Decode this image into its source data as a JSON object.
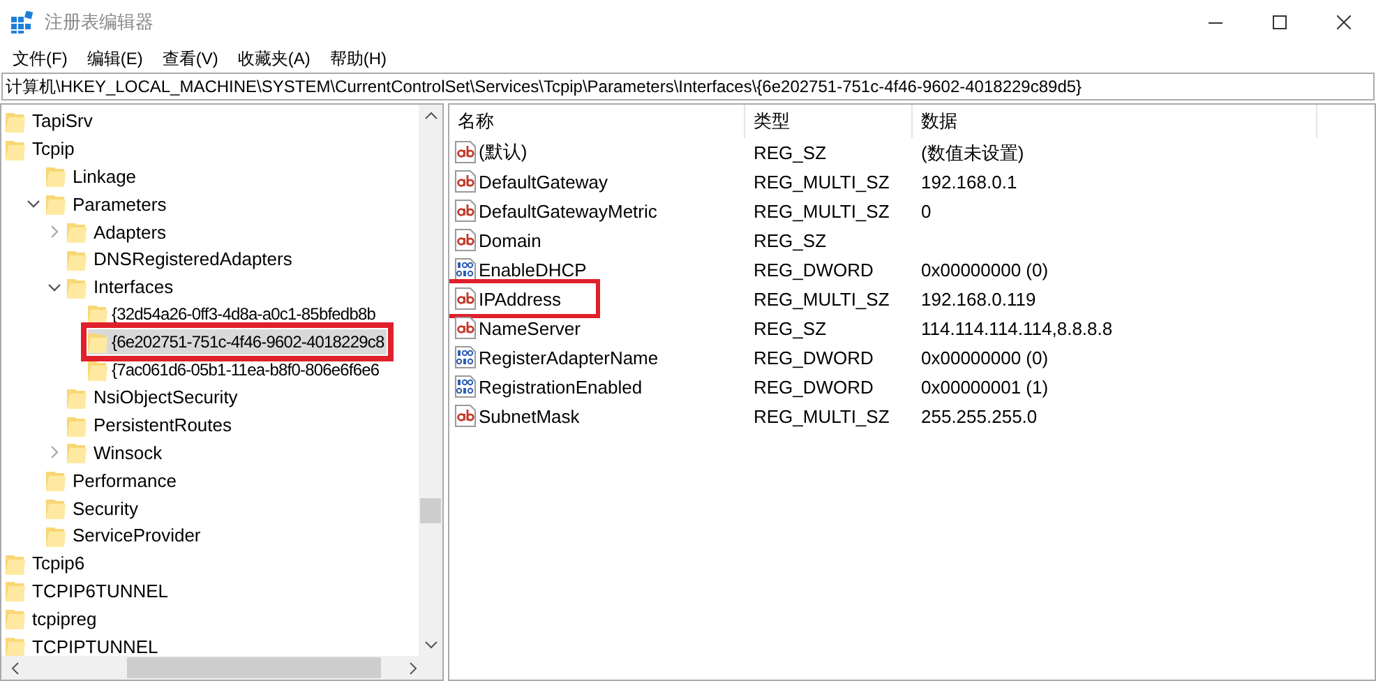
{
  "window": {
    "title": "注册表编辑器"
  },
  "menu": [
    "文件(F)",
    "编辑(E)",
    "查看(V)",
    "收藏夹(A)",
    "帮助(H)"
  ],
  "address": "计算机\\HKEY_LOCAL_MACHINE\\SYSTEM\\CurrentControlSet\\Services\\Tcpip\\Parameters\\Interfaces\\{6e202751-751c-4f46-9602-4018229c89d5}",
  "tree": [
    {
      "label": "TapiSrv",
      "selected": false
    },
    {
      "label": "Tcpip",
      "selected": false,
      "children": [
        {
          "label": "Linkage",
          "selected": false
        },
        {
          "label": "Parameters",
          "selected": false,
          "expanded": true,
          "children": [
            {
              "label": "Adapters",
              "selected": false,
              "expanded": false
            },
            {
              "label": "DNSRegisteredAdapters",
              "selected": false
            },
            {
              "label": "Interfaces",
              "selected": false,
              "expanded": true,
              "children": [
                {
                  "label": "{32d54a26-0ff3-4d8a-a0c1-85bfedb8b",
                  "selected": false
                },
                {
                  "label": "{6e202751-751c-4f46-9602-4018229c8",
                  "selected": true,
                  "highlighted": true
                },
                {
                  "label": "{7ac061d6-05b1-11ea-b8f0-806e6f6e6",
                  "selected": false
                }
              ]
            },
            {
              "label": "NsiObjectSecurity",
              "selected": false
            },
            {
              "label": "PersistentRoutes",
              "selected": false
            },
            {
              "label": "Winsock",
              "selected": false,
              "expanded": false
            }
          ]
        },
        {
          "label": "Performance",
          "selected": false
        },
        {
          "label": "Security",
          "selected": false
        },
        {
          "label": "ServiceProvider",
          "selected": false
        }
      ]
    },
    {
      "label": "Tcpip6",
      "selected": false
    },
    {
      "label": "TCPIP6TUNNEL",
      "selected": false
    },
    {
      "label": "tcpipreg",
      "selected": false
    },
    {
      "label": "TCPIPTUNNEL",
      "selected": false
    }
  ],
  "values": {
    "columns": [
      "名称",
      "类型",
      "数据"
    ],
    "rows": [
      {
        "kind": "string",
        "name": "(默认)",
        "type": "REG_SZ",
        "data": "(数值未设置)"
      },
      {
        "kind": "string",
        "name": "DefaultGateway",
        "type": "REG_MULTI_SZ",
        "data": "192.168.0.1"
      },
      {
        "kind": "string",
        "name": "DefaultGatewayMetric",
        "type": "REG_MULTI_SZ",
        "data": "0"
      },
      {
        "kind": "string",
        "name": "Domain",
        "type": "REG_SZ"
      },
      {
        "kind": "binary",
        "name": "EnableDHCP",
        "type": "REG_DWORD",
        "data": "0x00000000 (0)"
      },
      {
        "kind": "string",
        "name": "IPAddress",
        "type": "REG_MULTI_SZ",
        "data": "192.168.0.119",
        "highlighted": true
      },
      {
        "kind": "string",
        "name": "NameServer",
        "type": "REG_SZ",
        "data": "114.114.114.114,8.8.8.8"
      },
      {
        "kind": "binary",
        "name": "RegisterAdapterName",
        "type": "REG_DWORD",
        "data": "0x00000000 (0)"
      },
      {
        "kind": "binary",
        "name": "RegistrationEnabled",
        "type": "REG_DWORD",
        "data": "0x00000001 (1)"
      },
      {
        "kind": "string",
        "name": "SubnetMask",
        "type": "REG_MULTI_SZ",
        "data": "255.255.255.0"
      }
    ]
  }
}
